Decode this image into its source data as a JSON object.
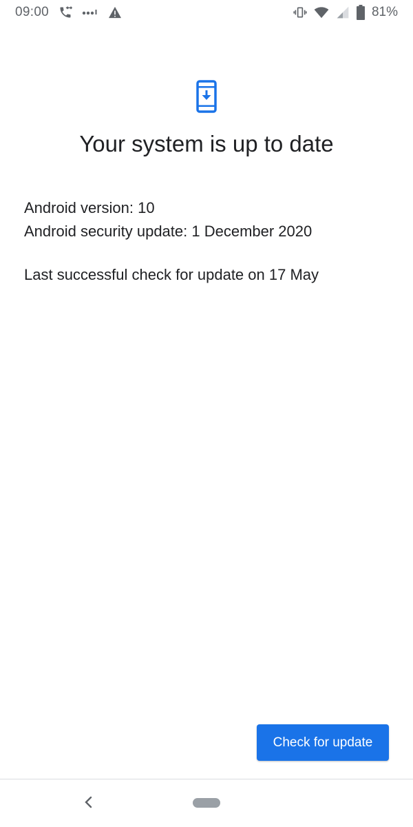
{
  "status_bar": {
    "time": "09:00",
    "battery_percent": "81%",
    "icons_left": [
      "call-forward-icon",
      "more-dots-icon",
      "warning-icon"
    ],
    "icons_right": [
      "vibrate-icon",
      "wifi-icon",
      "signal-icon",
      "battery-icon"
    ]
  },
  "content": {
    "icon": "system-update-icon",
    "title": "Your system is up to date",
    "android_version": "Android version: 10",
    "security_update": "Android security update: 1 December 2020",
    "last_check": "Last successful check for update on 17 May"
  },
  "actions": {
    "check_button_label": "Check for update"
  },
  "navigation": {
    "icons": [
      "back-icon",
      "home-pill-icon"
    ]
  },
  "colors": {
    "accent": "#1a73e8",
    "text_primary": "#202124",
    "status_icon": "#5f6368"
  }
}
